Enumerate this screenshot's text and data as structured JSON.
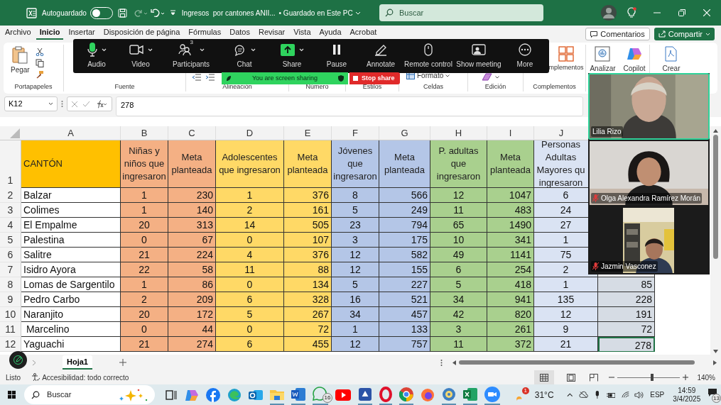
{
  "title_bar": {
    "autosave_label": "Autoguardado",
    "autosave_on": false,
    "document_title": "Ingresos  por cantones ANII...",
    "save_status": "• Guardado en Este PC",
    "search_placeholder": "Buscar"
  },
  "ribbon_tabs": [
    {
      "label": "Archivo",
      "selected": false
    },
    {
      "label": "Inicio",
      "selected": true
    },
    {
      "label": "Insertar",
      "selected": false
    },
    {
      "label": "Disposición de página",
      "selected": false
    },
    {
      "label": "Fórmulas",
      "selected": false
    },
    {
      "label": "Datos",
      "selected": false
    },
    {
      "label": "Revisar",
      "selected": false
    },
    {
      "label": "Vista",
      "selected": false
    },
    {
      "label": "Ayuda",
      "selected": false
    },
    {
      "label": "Acrobat",
      "selected": false
    }
  ],
  "ribbon_actions": {
    "comments": "Comentarios",
    "share": "Compartir"
  },
  "ribbon": {
    "paste": "Pegar",
    "format": "Formato",
    "complements_button": "mplementos",
    "analyze": "Analizar",
    "copilot": "Copilot",
    "create": "Crear",
    "groups": [
      "Portapapeles",
      "Fuente",
      "Alineación",
      "Número",
      "Estilos",
      "Celdas",
      "Edición",
      "Complementos"
    ]
  },
  "meeting_toolbar": [
    {
      "label": "Audio",
      "kind": "audio",
      "menu": true
    },
    {
      "label": "Video",
      "kind": "video",
      "menu": true
    },
    {
      "label": "Participants",
      "kind": "participants",
      "menu": true,
      "badge": "3"
    },
    {
      "label": "Chat",
      "kind": "chat",
      "menu": true
    },
    {
      "label": "Share",
      "kind": "share",
      "menu": true
    },
    {
      "label": "Pause",
      "kind": "pause",
      "menu": false
    },
    {
      "label": "Annotate",
      "kind": "annotate",
      "menu": false
    },
    {
      "label": "Remote control",
      "kind": "remote",
      "menu": false
    },
    {
      "label": "Show meeting",
      "kind": "show",
      "menu": false
    },
    {
      "label": "More",
      "kind": "more",
      "menu": false
    }
  ],
  "sharing_banner": {
    "message": "You are screen sharing",
    "stop": "Stop share"
  },
  "formula_bar": {
    "name_box": "K12",
    "value": "278"
  },
  "sheet": {
    "columns": [
      "A",
      "B",
      "C",
      "D",
      "E",
      "F",
      "G",
      "H",
      "I",
      "J"
    ],
    "header_row_number": "1",
    "headers": [
      "CANTÓN",
      "Niñas y\nniños que\ningresaron",
      "Meta\nplanteada",
      "Adolescentes\nque ingresaron",
      "Meta\nplanteada",
      "Jóvenes\nque\ningresaron",
      "Meta\nplanteada",
      "P. adultas\nque\ningresaron",
      "Meta\nplanteada",
      "Personas\nAdultas\nMayores qu\ningresaron"
    ],
    "rows": [
      {
        "number": "2",
        "canton": "Balzar",
        "values": [
          "1",
          "230",
          "1",
          "376",
          "8",
          "566",
          "12",
          "1047",
          "6"
        ],
        "selected": false
      },
      {
        "number": "3",
        "canton": "Colimes",
        "values": [
          "1",
          "140",
          "2",
          "161",
          "5",
          "249",
          "11",
          "483",
          "24"
        ],
        "selected": false
      },
      {
        "number": "4",
        "canton": "El Empalme",
        "values": [
          "20",
          "313",
          "14",
          "505",
          "23",
          "794",
          "65",
          "1490",
          "27"
        ],
        "selected": false
      },
      {
        "number": "5",
        "canton": "Palestina",
        "values": [
          "0",
          "67",
          "0",
          "107",
          "3",
          "175",
          "10",
          "341",
          "1"
        ],
        "selected": false
      },
      {
        "number": "6",
        "canton": "Salitre",
        "values": [
          "21",
          "224",
          "4",
          "376",
          "12",
          "582",
          "49",
          "1141",
          "75"
        ],
        "selected": false
      },
      {
        "number": "7",
        "canton": "Isidro Ayora",
        "values": [
          "22",
          "58",
          "11",
          "88",
          "12",
          "155",
          "6",
          "254",
          "2"
        ],
        "selected": false
      },
      {
        "number": "8",
        "canton": "Lomas de Sargentilo",
        "values": [
          "1",
          "86",
          "0",
          "134",
          "5",
          "227",
          "5",
          "418",
          "1",
          "85"
        ],
        "selected": false
      },
      {
        "number": "9",
        "canton": "Pedro Carbo",
        "values": [
          "2",
          "209",
          "6",
          "328",
          "16",
          "521",
          "34",
          "941",
          "135",
          "228"
        ],
        "selected": false
      },
      {
        "number": "10",
        "canton": "Naranjito",
        "values": [
          "20",
          "172",
          "5",
          "267",
          "34",
          "457",
          "42",
          "820",
          "12",
          "191"
        ],
        "selected": false
      },
      {
        "number": "11",
        "canton": " Marcelino",
        "values": [
          "0",
          "44",
          "0",
          "72",
          "1",
          "133",
          "3",
          "261",
          "9",
          "72"
        ],
        "selected": false
      },
      {
        "number": "12",
        "canton": "Yaguachi",
        "values": [
          "21",
          "274",
          "6",
          "455",
          "12",
          "757",
          "11",
          "372",
          "21",
          "278"
        ],
        "selected": true
      }
    ]
  },
  "video_panel": [
    {
      "name": "Lilia Rizo",
      "muted": false,
      "active": true
    },
    {
      "name": "Olga Alexandra Ramírez Morán",
      "muted": true,
      "active": false
    },
    {
      "name": "Jazmin Vasconez",
      "muted": true,
      "active": false
    }
  ],
  "sheet_tabs": [
    {
      "label": "Hoja1",
      "selected": true
    }
  ],
  "status_bar": {
    "ready": "Listo",
    "accessibility": "Accesibilidad: todo correcto",
    "zoom": "140%",
    "zoom_slider": {
      "level": 0.55
    }
  },
  "taskbar": {
    "search_placeholder": "Buscar",
    "whatsapp_badge": "16",
    "weather_badge": "1",
    "temperature": "31°C",
    "language": "ESP",
    "time": "14:59",
    "date": "3/4/2025",
    "notifications": "13"
  }
}
